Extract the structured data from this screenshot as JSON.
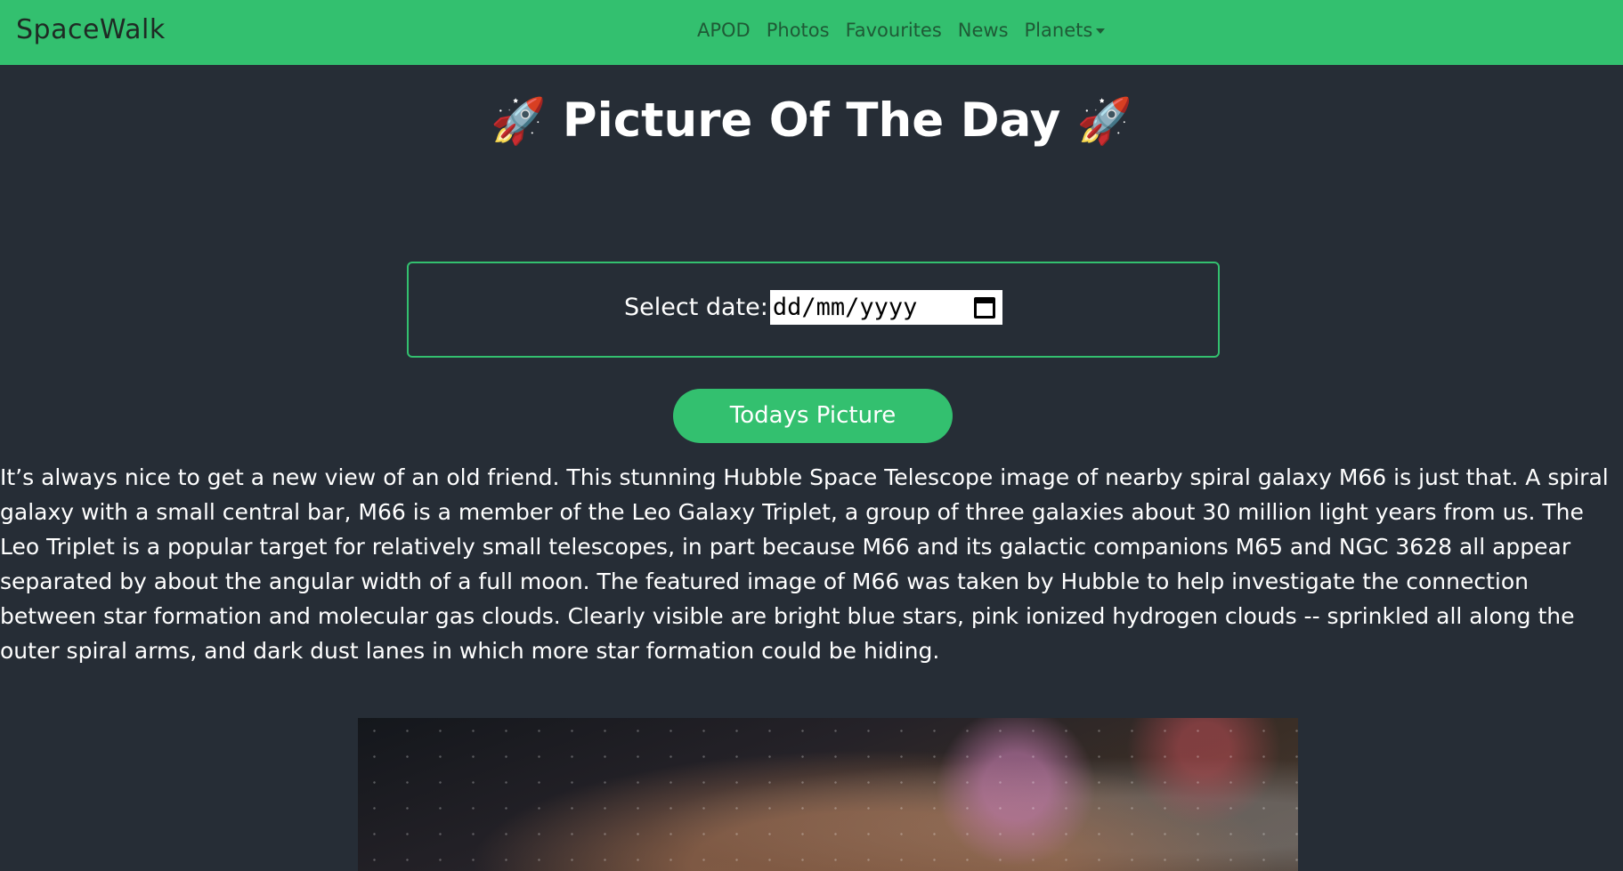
{
  "navbar": {
    "brand": "SpaceWalk",
    "links": [
      "APOD",
      "Photos",
      "Favourites",
      "News",
      "Planets"
    ],
    "bg_color": "#33c06f"
  },
  "header": {
    "title": "Picture Of The Day",
    "icon_left": "rocket-icon",
    "icon_right": "rocket-icon"
  },
  "date_picker": {
    "label": "Select date:",
    "placeholder": "dd/mm/yyyy"
  },
  "today_button": {
    "label": "Todays Picture"
  },
  "description": "It’s always nice to get a new view of an old friend. This stunning Hubble Space Telescope image of nearby spiral galaxy M66 is just that. A spiral galaxy with a small central bar, M66 is a member of the Leo Galaxy Triplet, a group of three galaxies about 30 million light years from us. The Leo Triplet is a popular target for relatively small telescopes, in part because M66 and its galactic companions M65 and NGC 3628 all appear separated by about the angular width of a full moon. The featured image of M66 was taken by Hubble to help investigate the connection between star formation and molecular gas clouds. Clearly visible are bright blue stars, pink ionized hydrogen clouds -- sprinkled all along the outer spiral arms, and dark dust lanes in which more star formation could be hiding.",
  "colors": {
    "accent": "#33c06f",
    "background": "#262d36"
  }
}
